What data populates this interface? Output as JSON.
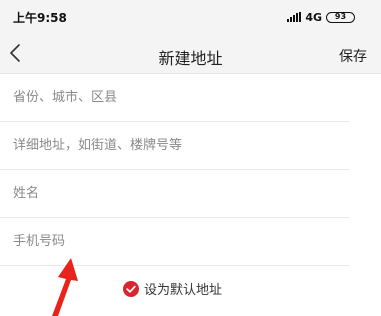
{
  "status_bar": {
    "time": "上午9:58",
    "network": "4G",
    "battery": "93"
  },
  "nav": {
    "title": "新建地址",
    "save_label": "保存"
  },
  "form": {
    "fields": [
      {
        "placeholder": "省份、城市、区县",
        "value": ""
      },
      {
        "placeholder": "详细地址，如街道、楼牌号等",
        "value": ""
      },
      {
        "placeholder": "姓名",
        "value": ""
      },
      {
        "placeholder": "手机号码",
        "value": ""
      }
    ]
  },
  "default_address": {
    "label": "设为默认地址",
    "checked": true,
    "color": "#d9252e"
  },
  "annotation": {
    "color": "#e8231b"
  }
}
